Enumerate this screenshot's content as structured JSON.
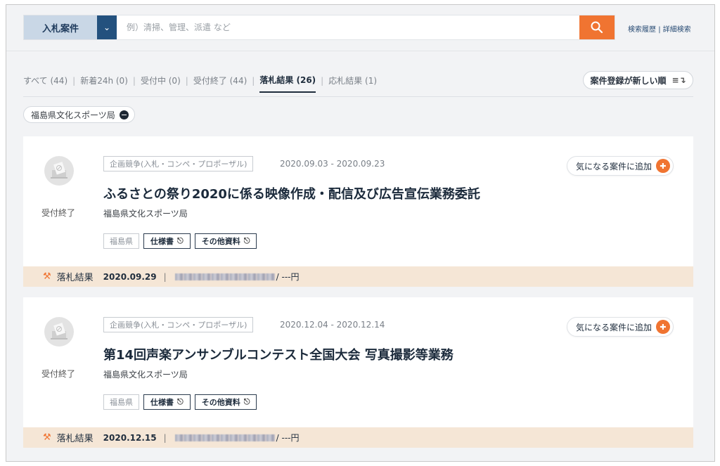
{
  "search": {
    "category_label": "入札案件",
    "placeholder": "例）清掃、管理、派遣 など",
    "history_link": "検索履歴",
    "link_separator": "|",
    "advanced_link": "詳細検索"
  },
  "tabs": [
    {
      "label": "すべて (44)"
    },
    {
      "label": "新着24h (0)"
    },
    {
      "label": "受付中 (0)"
    },
    {
      "label": "受付終了 (44)"
    },
    {
      "label": "落札結果 (26)",
      "active": true
    },
    {
      "label": "応札結果 (1)"
    }
  ],
  "tab_separator": "|",
  "sort": {
    "label": "案件登録が新しい順",
    "icon": "sort-descending-icon"
  },
  "filter_chip": {
    "label": "福島県文化スポーツ局"
  },
  "cards": [
    {
      "status": "受付終了",
      "kind": "企画競争(入札・コンペ・プロポーザル)",
      "period": "2020.09.03 - 2020.09.23",
      "title": "ふるさとの祭り2020に係る映像作成・配信及び広告宣伝業務委託",
      "org": "福島県文化スポーツ局",
      "prefecture": "福島県",
      "doc1": "仕様書",
      "doc2": "その他資料",
      "fav_label": "気になる案件に追加",
      "result_label": "落札結果",
      "result_date": "2020.09.29",
      "result_sep": "|",
      "price": "/ ---円"
    },
    {
      "status": "受付終了",
      "kind": "企画競争(入札・コンペ・プロポーザル)",
      "period": "2020.12.04 - 2020.12.14",
      "title": "第14回声楽アンサンブルコンテスト全国大会 写真撮影等業務",
      "org": "福島県文化スポーツ局",
      "prefecture": "福島県",
      "doc1": "仕様書",
      "doc2": "その他資料",
      "fav_label": "気になる案件に追加",
      "result_label": "落札結果",
      "result_date": "2020.12.15",
      "result_sep": "|",
      "price": "/ ---円"
    }
  ],
  "colors": {
    "accent": "#f07431",
    "navy": "#23517e",
    "result_bar": "#f5e6d6"
  }
}
